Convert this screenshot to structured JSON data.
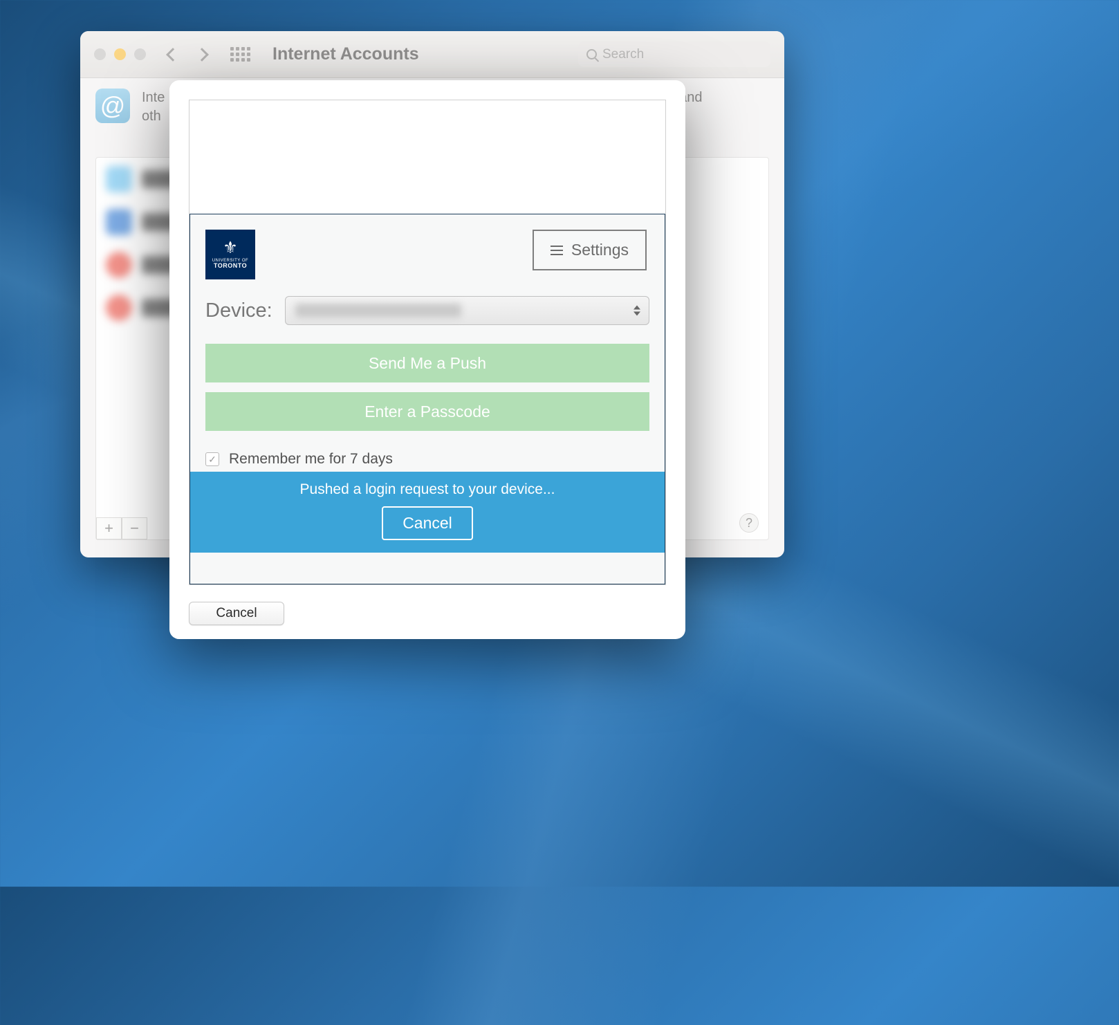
{
  "window": {
    "title": "Internet Accounts",
    "search_placeholder": "Search",
    "info_prefix": "Inte",
    "info_rest": " and",
    "info_line2": "oth"
  },
  "duo": {
    "logo_univ": "UNIVERSITY OF",
    "logo_name": "TORONTO",
    "settings_label": "Settings",
    "device_label": "Device:",
    "push_label": "Send Me a Push",
    "passcode_label": "Enter a Passcode",
    "remember_label": "Remember me for 7 days",
    "status_text": "Pushed a login request to your device...",
    "banner_cancel": "Cancel"
  },
  "sheet": {
    "cancel_label": "Cancel"
  },
  "footer": {
    "plus": "+",
    "minus": "−",
    "help": "?"
  }
}
